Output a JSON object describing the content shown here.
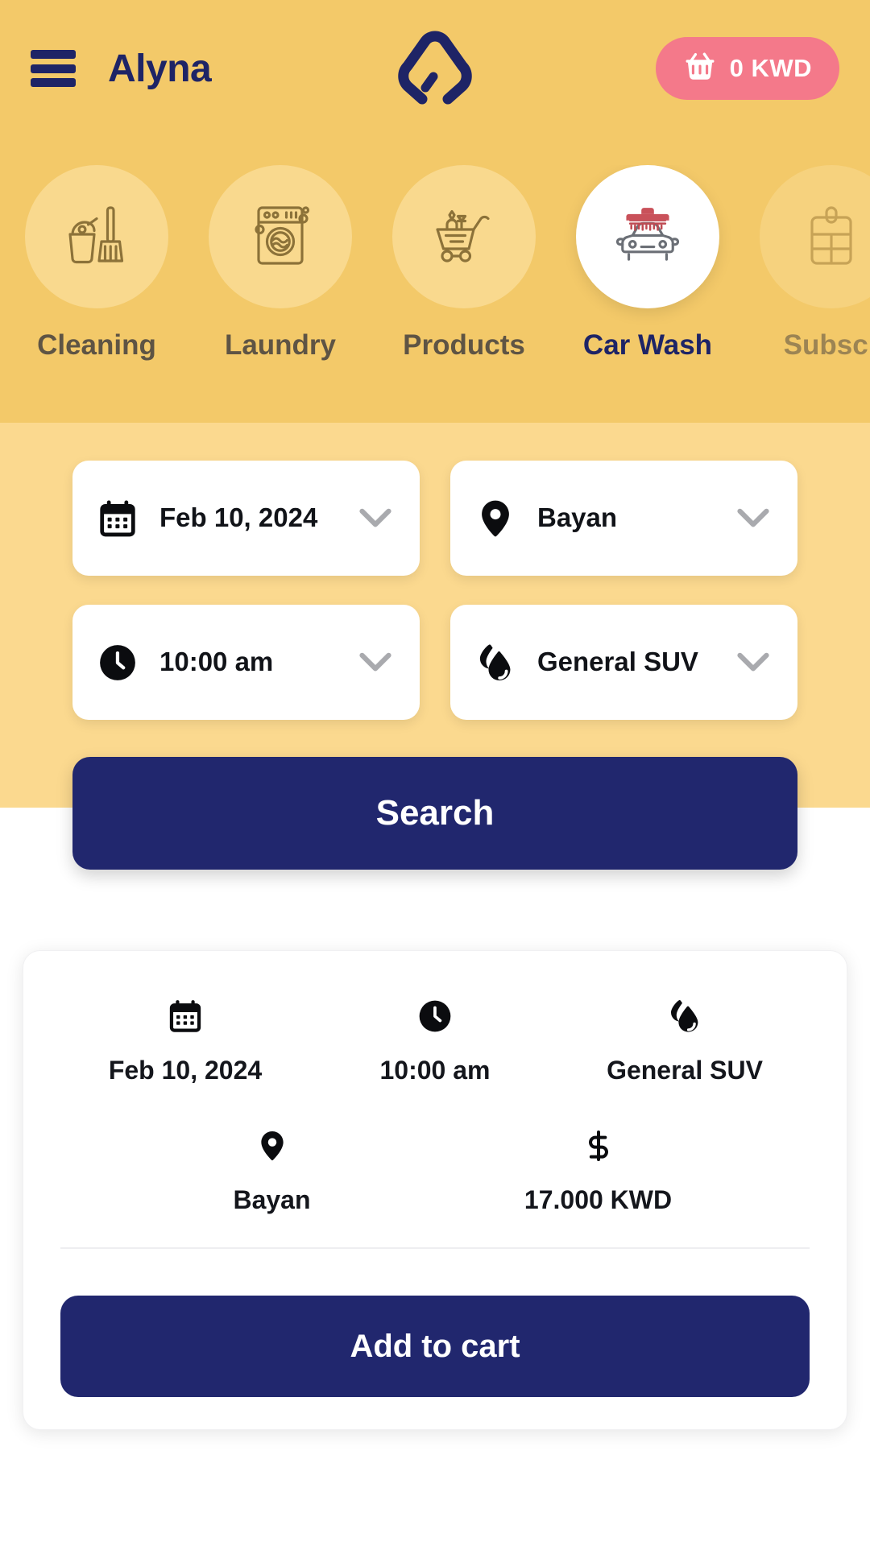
{
  "header": {
    "menu_icon": "hamburger-icon",
    "brand": "Alyna",
    "logo_icon": "alyna-a-logo",
    "cart": {
      "icon": "basket-icon",
      "amount": "0 KWD"
    }
  },
  "categories": [
    {
      "label": "Cleaning",
      "icon": "bucket-broom-icon",
      "active": false
    },
    {
      "label": "Laundry",
      "icon": "washing-machine-icon",
      "active": false
    },
    {
      "label": "Products",
      "icon": "shopping-cart-icon",
      "active": false
    },
    {
      "label": "Car Wash",
      "icon": "car-wash-icon",
      "active": true
    },
    {
      "label": "Subscr",
      "icon": "subscription-card-icon",
      "active": false
    }
  ],
  "filters": [
    {
      "name": "date",
      "icon": "calendar-icon",
      "value": "Feb 10, 2024"
    },
    {
      "name": "location",
      "icon": "map-pin-icon",
      "value": "Bayan"
    },
    {
      "name": "time",
      "icon": "clock-icon",
      "value": "10:00 am"
    },
    {
      "name": "service",
      "icon": "droplets-icon",
      "value": "General SUV"
    }
  ],
  "search_button": "Search",
  "result_card": {
    "row1": [
      {
        "icon": "calendar-icon",
        "label": "Feb 10, 2024"
      },
      {
        "icon": "clock-icon",
        "label": "10:00 am"
      },
      {
        "icon": "droplets-icon",
        "label": "General SUV"
      }
    ],
    "row2": [
      {
        "icon": "map-pin-icon",
        "label": "Bayan"
      },
      {
        "icon": "dollar-icon",
        "label": "17.000 KWD"
      }
    ],
    "add_button": "Add to cart"
  },
  "colors": {
    "header_yellow": "#F3C969",
    "filters_yellow": "#FBD98F",
    "navy": "#21276E",
    "brand_navy": "#1E2466",
    "cart_pink": "#F4798A",
    "card_white": "#FFFFFF"
  }
}
